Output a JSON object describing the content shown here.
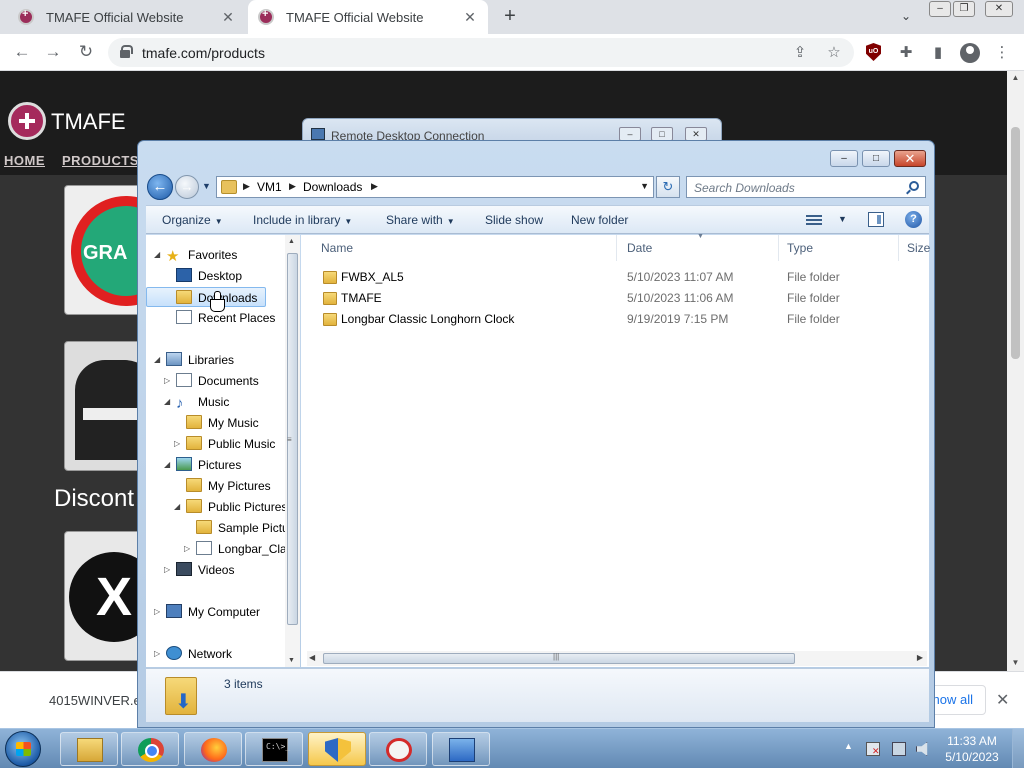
{
  "browser": {
    "tabs": [
      {
        "title": "TMAFE Official Website",
        "active": false
      },
      {
        "title": "TMAFE Official Website",
        "active": true
      }
    ],
    "url": "tmafe.com/products"
  },
  "website": {
    "logo_text": "TMAFE",
    "nav": [
      "HOME",
      "PRODUCTS"
    ],
    "card_text": "GRA",
    "heading_partial": "Discont",
    "icon_letter": "X"
  },
  "download_bar": {
    "filename": "4015WINVER.e",
    "show_all": "how all"
  },
  "remote_desktop": {
    "title": "Remote Desktop Connection"
  },
  "explorer": {
    "breadcrumb": [
      "VM1",
      "Downloads"
    ],
    "search_placeholder": "Search Downloads",
    "commands": [
      "Organize",
      "Include in library",
      "Share with",
      "Slide show",
      "New folder"
    ],
    "nav_tree": {
      "favorites_label": "Favorites",
      "favorites": [
        "Desktop",
        "Downloads",
        "Recent Places"
      ],
      "libraries_label": "Libraries",
      "documents": "Documents",
      "music": "Music",
      "my_music": "My Music",
      "public_music": "Public Music",
      "pictures": "Pictures",
      "my_pictures": "My Pictures",
      "public_pictures": "Public Pictures",
      "sample_pictures": "Sample Pictu",
      "longbar": "Longbar_Clas",
      "videos": "Videos",
      "my_computer": "My Computer",
      "network": "Network"
    },
    "columns": [
      "Name",
      "Date",
      "Type",
      "Size"
    ],
    "rows": [
      {
        "name": "FWBX_AL5",
        "date": "5/10/2023 11:07 AM",
        "type": "File folder"
      },
      {
        "name": "TMAFE",
        "date": "5/10/2023 11:06 AM",
        "type": "File folder"
      },
      {
        "name": "Longbar Classic Longhorn Clock",
        "date": "9/19/2019 7:15 PM",
        "type": "File folder"
      }
    ],
    "status": "3 items"
  },
  "taskbar": {
    "time": "11:33 AM",
    "date": "5/10/2023",
    "cmd_glyph": "C:\\>_"
  },
  "colors": {
    "chrome_tabstrip": "#dee1e6",
    "explorer_frame": "#c9dcf0",
    "selection": "#c7e1fb",
    "close_red": "#c7452a",
    "taskbar": "#6289b3"
  }
}
